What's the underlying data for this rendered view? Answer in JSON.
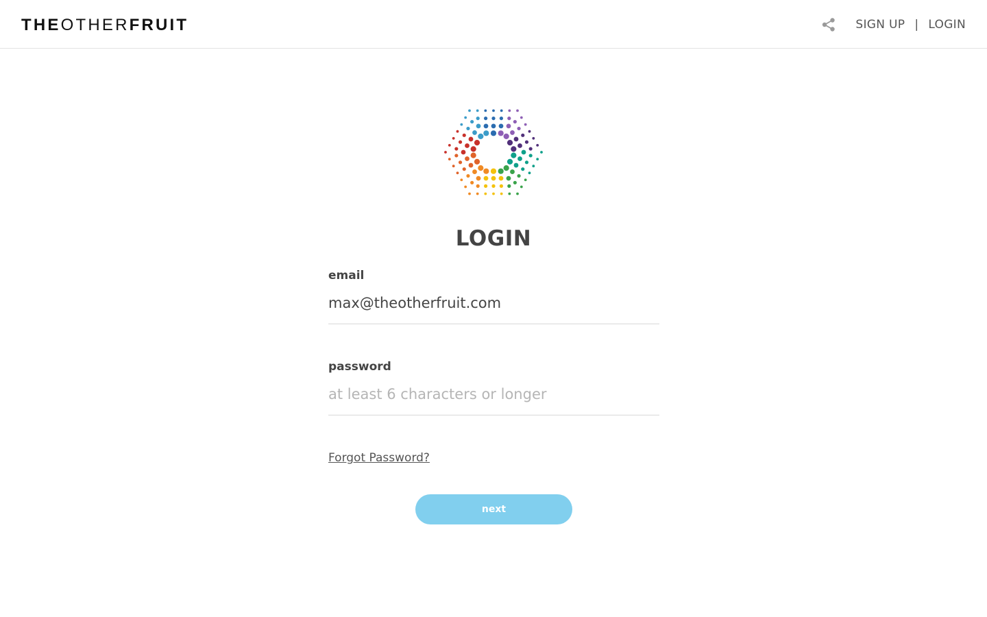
{
  "header": {
    "brand": {
      "part1": "THE",
      "part2": "OTHER",
      "part3": "FRUIT"
    },
    "share_icon": "share-icon",
    "nav": {
      "signup_label": "SIGN UP",
      "separator": "|",
      "login_label": "LOGIN"
    }
  },
  "logo": {
    "icon": "dotted-hexagon-logo",
    "colors": [
      "#2b6cb0",
      "#8e5fb5",
      "#51307a",
      "#0fa08a",
      "#3aa34b",
      "#f4c20d",
      "#f08a24",
      "#e0632a",
      "#c8312b",
      "#3b9cc9"
    ]
  },
  "form": {
    "title": "LOGIN",
    "email": {
      "label": "email",
      "value": "max@theotherfruit.com"
    },
    "password": {
      "label": "password",
      "placeholder": "at least 6 characters or longer",
      "value": ""
    },
    "forgot_label": "Forgot Password?",
    "next_label": "next"
  },
  "colors": {
    "button_bg": "#81cfee",
    "text": "#444444",
    "placeholder": "#b5b5b5",
    "divider": "#d8d8d8"
  }
}
